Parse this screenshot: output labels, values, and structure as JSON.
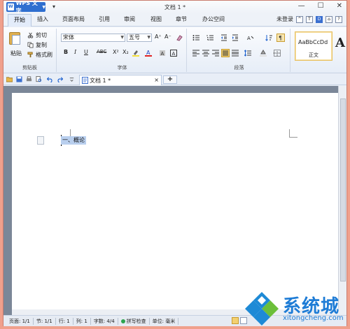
{
  "app": {
    "button_label": "WPS 文字",
    "logo_glyph": "W",
    "title": "文档 1 *",
    "qat_glyph": "▾",
    "window_controls": [
      "—",
      "☐",
      "✕"
    ]
  },
  "tabs": [
    "开始",
    "插入",
    "页面布局",
    "引用",
    "审阅",
    "视图",
    "章节",
    "办公空间"
  ],
  "tabbar_right": {
    "save_status": "未登录",
    "icons": [
      "^",
      "T",
      "D",
      "⌂",
      "?"
    ]
  },
  "clipboard": {
    "paste": "粘贴",
    "cut": "剪切",
    "copy": "复制",
    "format_painter": "格式刷",
    "group_label": "剪贴板"
  },
  "font": {
    "font_name": "宋体",
    "font_size": "五号",
    "group_label": "字体",
    "buttons": [
      "A⁺",
      "A⁻",
      "B",
      "I",
      "U",
      "ABC",
      "X²",
      "X₂"
    ]
  },
  "paragraph": {
    "group_label": "段落"
  },
  "styles": {
    "sample": "AaBbCcDd",
    "name": "正文",
    "next_sample": "A"
  },
  "doc_tabs": {
    "active": "文档 1 *",
    "close": "×",
    "new": "+"
  },
  "document": {
    "heading_text": "一、概论"
  },
  "status": {
    "page": "页面: 1/1",
    "section": "节: 1/1",
    "row": "行: 1",
    "col": "列: 1",
    "words": "字数: 4/4",
    "spell": "拼写检查",
    "unit": "单位: 毫米"
  },
  "watermark": {
    "text": "系统城",
    "url": "xitongcheng.com"
  },
  "colors": {
    "accent": "#2f6fd0",
    "border_outer": "#f0a08c",
    "selection": "#b9cfee",
    "watermark": "#1e7cd6"
  }
}
